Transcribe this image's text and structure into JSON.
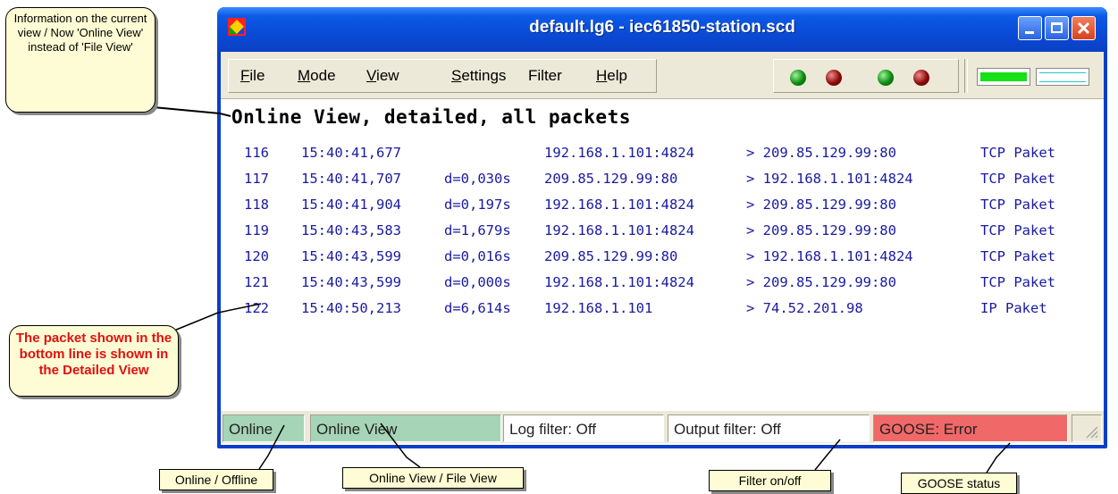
{
  "window": {
    "title": "default.lg6 - iec61850-station.scd",
    "menu": [
      {
        "label": "File",
        "key": "F",
        "rest": "ile"
      },
      {
        "label": "Mode",
        "key": "M",
        "rest": "ode"
      },
      {
        "label": "View",
        "key": "V",
        "rest": "iew"
      },
      {
        "label": "Settings",
        "key": "S",
        "rest": "ettings"
      },
      {
        "label": "Filter",
        "key": "",
        "rest": "Filter"
      },
      {
        "label": "Help",
        "key": "H",
        "rest": "elp"
      }
    ],
    "leds": [
      "green",
      "red",
      "green",
      "red"
    ],
    "view_header": "Online View, detailed, all packets",
    "packets": [
      {
        "num": "116",
        "time": "15:40:41,677",
        "delta": "",
        "src": "192.168.1.101:4824",
        "dst": "> 209.85.129.99:80",
        "type": "TCP Paket"
      },
      {
        "num": "117",
        "time": "15:40:41,707",
        "delta": "d=0,030s",
        "src": "209.85.129.99:80",
        "dst": "> 192.168.1.101:4824",
        "type": "TCP Paket"
      },
      {
        "num": "118",
        "time": "15:40:41,904",
        "delta": "d=0,197s",
        "src": "192.168.1.101:4824",
        "dst": "> 209.85.129.99:80",
        "type": "TCP Paket"
      },
      {
        "num": "119",
        "time": "15:40:43,583",
        "delta": "d=1,679s",
        "src": "192.168.1.101:4824",
        "dst": "> 209.85.129.99:80",
        "type": "TCP Paket"
      },
      {
        "num": "120",
        "time": "15:40:43,599",
        "delta": "d=0,016s",
        "src": "209.85.129.99:80",
        "dst": "> 192.168.1.101:4824",
        "type": "TCP Paket"
      },
      {
        "num": "121",
        "time": "15:40:43,599",
        "delta": "d=0,000s",
        "src": "192.168.1.101:4824",
        "dst": "> 209.85.129.99:80",
        "type": "TCP Paket"
      },
      {
        "num": "122",
        "time": "15:40:50,213",
        "delta": "d=6,614s",
        "src": "192.168.1.101",
        "dst": "> 74.52.201.98",
        "type": "IP Paket"
      }
    ],
    "status": {
      "online": "Online",
      "view": "Online View",
      "log_filter": "Log filter: Off",
      "output_filter": "Output filter: Off",
      "goose": "GOOSE: Error"
    },
    "colors": {
      "online_green": "#a6d4b6",
      "goose_error": "#f06868",
      "packet_text": "#1a1aa0"
    }
  },
  "callouts": {
    "info": "Information on the current view / Now 'Online View' instead of 'File View'",
    "packet": "The packet shown in the bottom line is shown in the Detailed View",
    "online_offline": "Online / Offline",
    "view_mode": "Online View / File View",
    "filter": "Filter on/off",
    "goose": "GOOSE status"
  }
}
